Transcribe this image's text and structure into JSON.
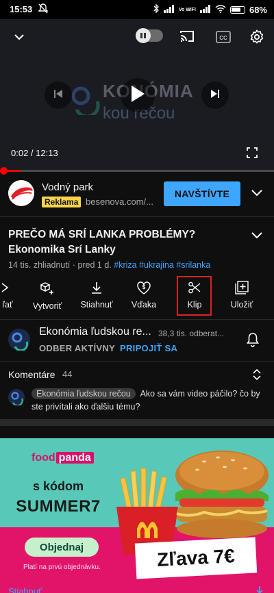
{
  "status_bar": {
    "time": "15:53",
    "network": "Vo WiFi",
    "battery": "68%"
  },
  "player": {
    "current_time": "0:02",
    "duration": "12:13",
    "time_label": "0:02 / 12:13",
    "progress_fraction": 0.0027,
    "watermark_line1": "KONÓMIA",
    "watermark_line2": "kou rečou",
    "icons": [
      "chevron-down-icon",
      "pause-icon",
      "cast-icon",
      "cc-icon",
      "settings-icon",
      "previous-icon",
      "play-icon",
      "next-icon",
      "fullscreen-icon"
    ]
  },
  "ad": {
    "title": "Vodný park",
    "badge": "Reklama",
    "domain": "besenova.com/...",
    "cta": "NAVŠTÍVTE"
  },
  "video": {
    "title": "PREČO MÁ SRÍ LANKA PROBLÉMY? Ekonomika Srí Lanky",
    "meta_prefix": "14 tis. zhliadnutí · pred 1 d.",
    "tags": [
      "#kriza",
      "#ukrajina",
      "#srilanka"
    ]
  },
  "actions": [
    {
      "label": "ľať",
      "icon": "share-icon"
    },
    {
      "label": "Vytvoriť",
      "icon": "create-icon"
    },
    {
      "label": "Stiahnuť",
      "icon": "download-icon"
    },
    {
      "label": "Vďaka",
      "icon": "thanks-icon"
    },
    {
      "label": "Klip",
      "icon": "scissors-icon"
    },
    {
      "label": "Uložiť",
      "icon": "save-icon"
    }
  ],
  "channel": {
    "name": "Ekonómia ľudskou re...",
    "subscribers": "38,3 tis. odberat...",
    "status": "ODBER AKTÍVNY",
    "join": "PRIPOJIŤ SA"
  },
  "comments": {
    "title": "Komentáre",
    "count": "44",
    "author_chip": "Ekonómia ľudskou rečou",
    "text": "Ako sa vám video páčilo? čo by ste privítali ako ďalšiu tému?"
  },
  "banner": {
    "brand_a": "food",
    "brand_b": "panda",
    "line1": "s kódom",
    "line2": "SUMMER7",
    "button": "Objednaj",
    "small": "Platí na prvú objednávku.",
    "discount": "Zľava 7€",
    "bottom": "Stiahnuť"
  },
  "colors": {
    "accent_blue": "#3ea6ff",
    "red": "#ff0000",
    "ad_yellow": "#f9d44b",
    "banner_teal": "#58c9b8",
    "banner_pink": "#e2146a"
  }
}
